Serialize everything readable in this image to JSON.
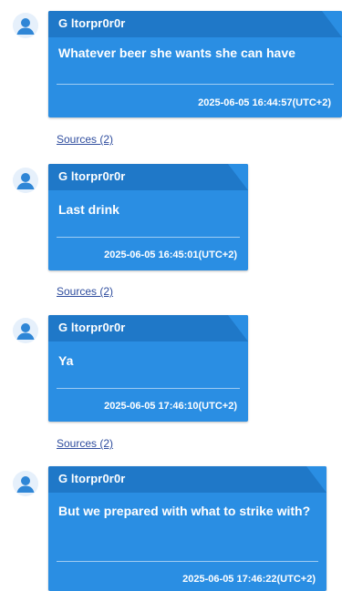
{
  "messages": [
    {
      "sender": "G ltorpr0r0r",
      "text": "Whatever beer she wants she can have",
      "timestamp": "2025-06-05 16:44:57(UTC+2)",
      "sources": "Sources (2)"
    },
    {
      "sender": "G ltorpr0r0r",
      "text": "Last drink",
      "timestamp": "2025-06-05 16:45:01(UTC+2)",
      "sources": "Sources (2)"
    },
    {
      "sender": "G ltorpr0r0r",
      "text": "Ya",
      "timestamp": "2025-06-05 17:46:10(UTC+2)",
      "sources": "Sources (2)"
    },
    {
      "sender": "G ltorpr0r0r",
      "text": "But we prepared with what to strike with?",
      "timestamp": "2025-06-05 17:46:22(UTC+2)",
      "sources": ""
    }
  ],
  "colors": {
    "bubble": "#2a8ee3",
    "bubble_header": "#1f78c8",
    "link": "#2f4d9e",
    "avatar_bg": "#e6f0fb",
    "avatar_fg": "#2f86d6"
  }
}
